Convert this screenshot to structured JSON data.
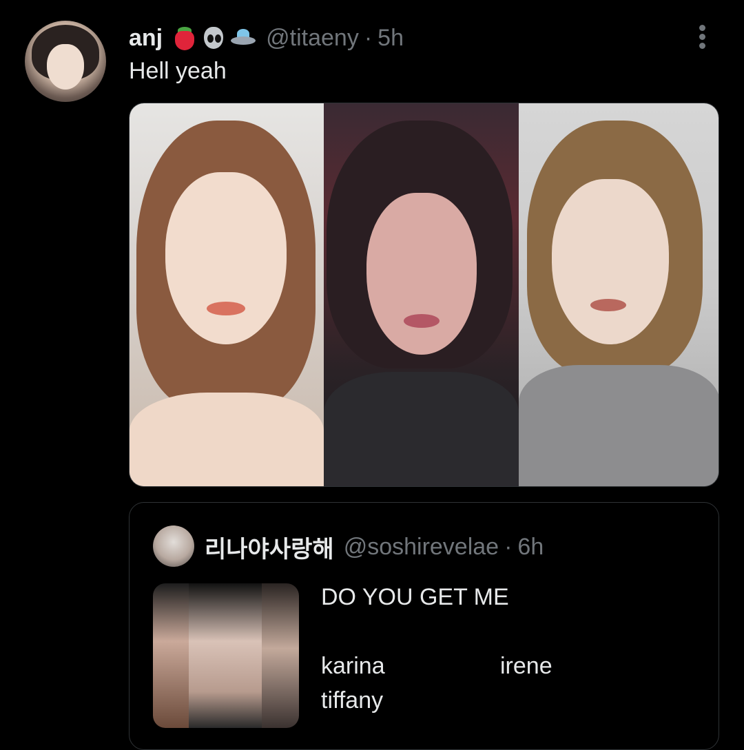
{
  "tweet": {
    "display_name": "anj",
    "emojis": [
      "strawberry-emoji",
      "alien-emoji",
      "ufo-emoji"
    ],
    "handle": "@titaeny",
    "separator": "·",
    "time": "5h",
    "text": "Hell yeah",
    "media": [
      {
        "icon": "photo-1"
      },
      {
        "icon": "photo-2"
      },
      {
        "icon": "photo-3"
      }
    ]
  },
  "quote": {
    "display_name": "리나야사랑해",
    "handle": "@soshirevelae",
    "separator": "·",
    "time": "6h",
    "line1": "DO YOU GET ME",
    "names": [
      "karina",
      "irene",
      "tiffany"
    ]
  },
  "colors": {
    "background": "#000000",
    "text": "#e7e9ea",
    "secondary": "#71767b",
    "border": "#2f3336"
  }
}
